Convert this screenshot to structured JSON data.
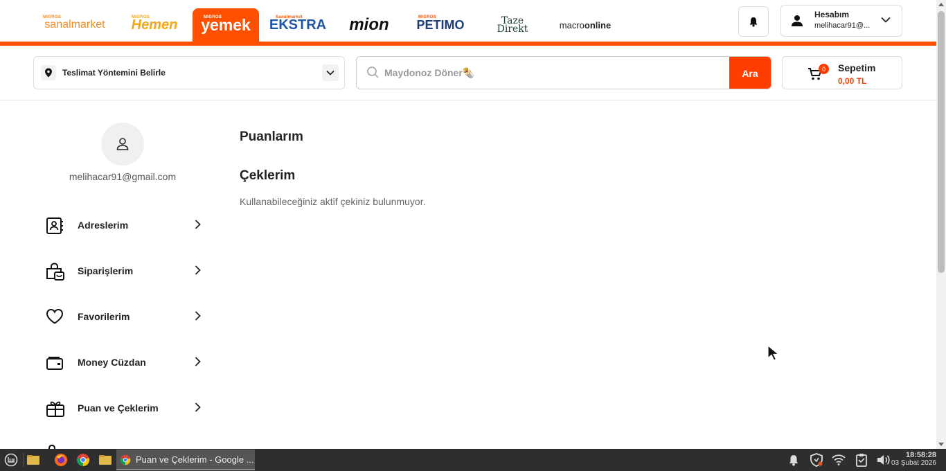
{
  "brands": {
    "sanal_small": "MIGROS",
    "sanal": "sanalmarket",
    "hemen_small": "MIGROS",
    "hemen": "Hemen",
    "yemek_small": "MIGROS",
    "yemek": "yemek",
    "ekstra_small": "Sanalmarket",
    "ekstra": "EKSTRA",
    "mion": "mion",
    "petimo_small": "MIGROS",
    "petimo": "PETIMO",
    "taze_line1": "Taze",
    "taze_line2": "Direkt",
    "macro_a": "macro",
    "macro_b": "online"
  },
  "header": {
    "account_title": "Hesabım",
    "account_email": "melihacar91@...",
    "delivery_label": "Teslimat Yöntemini Belirle",
    "search_placeholder": "Maydonoz Döner🌯",
    "search_button": "Ara",
    "cart_title": "Sepetim",
    "cart_total": "0,00 TL",
    "cart_count": "0"
  },
  "sidebar": {
    "email": "melihacar91@gmail.com",
    "items": [
      {
        "label": "Adreslerim",
        "icon": "address-book-icon"
      },
      {
        "label": "Siparişlerim",
        "icon": "shopping-bag-icon"
      },
      {
        "label": "Favorilerim",
        "icon": "heart-icon"
      },
      {
        "label": "Money Cüzdan",
        "icon": "wallet-icon"
      },
      {
        "label": "Puan ve Çeklerim",
        "icon": "gift-icon"
      }
    ]
  },
  "content": {
    "points_heading": "Puanlarım",
    "checks_heading": "Çeklerim",
    "empty_message": "Kullanabileceğiniz aktif çekiniz bulunmuyor."
  },
  "taskbar": {
    "window_title": "Puan ve Çeklerim - Google ...",
    "time": "18:58:28",
    "date": "03 Şubat 2026"
  },
  "colors": {
    "brand_orange": "#ff5000",
    "search_button": "#ff3d00"
  }
}
